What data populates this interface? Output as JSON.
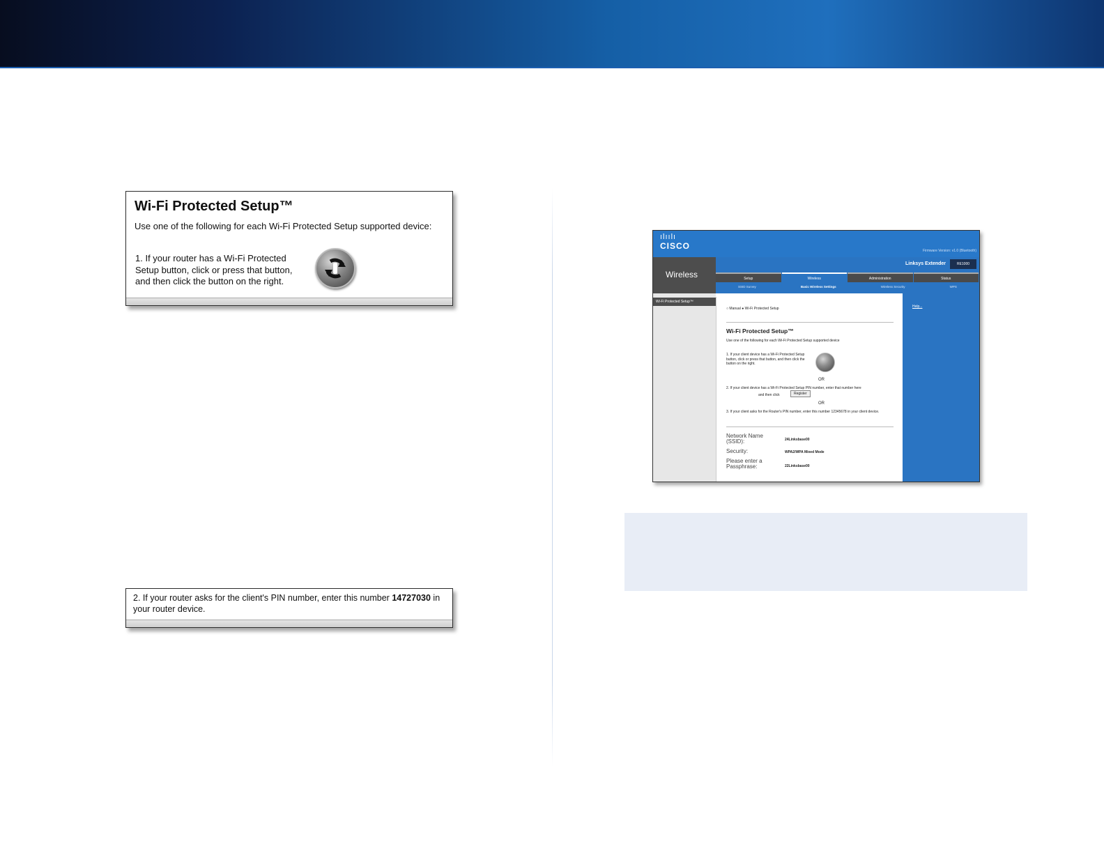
{
  "wps_panel": {
    "title": "Wi-Fi Protected Setup™",
    "intro": "Use one of the following for each Wi-Fi Protected Setup supported device:",
    "step1": "1. If your router has a Wi-Fi Protected Setup button, click or press that button, and then click the button on the right."
  },
  "pin_panel": {
    "prefix": "2. If your router asks for the client's PIN number, enter this number ",
    "pin": "14727030",
    "suffix": " in your router device."
  },
  "router_screenshot": {
    "logo_bars": "ılıılı",
    "brand": "CISCO",
    "firmware": "Firmware Version: v1.0 (Bluetooth)",
    "section": "Wireless",
    "product": "Linksys Extender",
    "model": "RE1000",
    "tabs": [
      "Setup",
      "Wireless",
      "Administration",
      "Status"
    ],
    "subtabs": [
      "SSID Survey",
      "Basic Wireless Settings",
      "Wireless Security",
      "WPS"
    ],
    "sidebar_item": "Wi-Fi Protected Setup™",
    "mode_manual": "Manual",
    "mode_wps": "Wi-Fi Protected Setup",
    "title": "Wi-Fi Protected Setup™",
    "intro": "Use one of the following for each Wi-Fi Protected Setup supported device",
    "step1": "1. If your client device has a Wi-Fi Protected Setup button, click or press that button, and then click the button on the right.",
    "or": "OR",
    "step2a": "2. If your client device has a Wi-Fi Protected Setup PIN number, enter that number here",
    "step2b": "and then click",
    "register": "Register",
    "step3": "3. If your client asks for the Router's PIN number, enter this number 12345678 in your client device.",
    "network_name_label": "Network Name (SSID):",
    "network_name_value": "24Linksbase00",
    "security_label": "Security:",
    "security_value": "WPA2/WPA Mixed Mode",
    "passphrase_label": "Please enter a Passphrase:",
    "passphrase_value": "22Linksbase00",
    "help": "Help..."
  },
  "colors": {
    "banner_blue": "#155fa6",
    "router_blue": "#2a74c2",
    "note_bg": "#e8edf6"
  }
}
